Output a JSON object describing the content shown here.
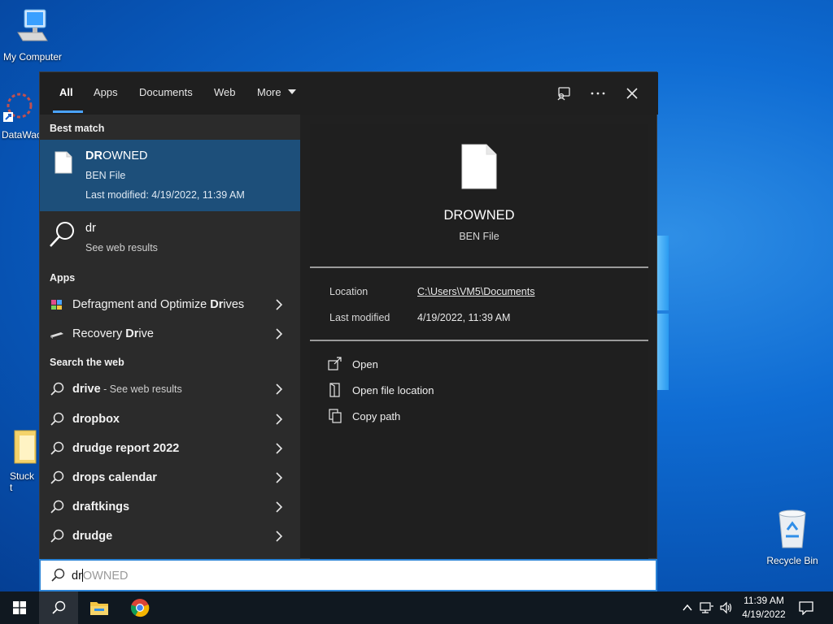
{
  "desktop": {
    "icons": [
      {
        "label": "My Computer"
      },
      {
        "label": "DataWac"
      },
      {
        "label": "Stuck t"
      },
      {
        "label": "Recycle Bin"
      }
    ]
  },
  "tabs": {
    "items": [
      "All",
      "Apps",
      "Documents",
      "Web",
      "More"
    ],
    "active": "All"
  },
  "best_match": {
    "header": "Best match",
    "name_match": "DR",
    "name_rest": "OWNED",
    "type": "BEN File",
    "modified": "Last modified: 4/19/2022, 11:39 AM"
  },
  "web_result": {
    "query": "dr",
    "label": "See web results"
  },
  "apps": {
    "header": "Apps",
    "items": [
      {
        "plain": "Defragment and Optimize ",
        "bold": "Dr",
        "rest": "ives"
      },
      {
        "plain": "Recovery ",
        "bold": "Dr",
        "rest": "ive"
      }
    ]
  },
  "search_web": {
    "header": "Search the web",
    "items": [
      {
        "text": "drive",
        "sub": " - See web results"
      },
      {
        "text": "dropbox",
        "sub": ""
      },
      {
        "text": "drudge report 2022",
        "sub": ""
      },
      {
        "text": "drops calendar",
        "sub": ""
      },
      {
        "text": "draftkings",
        "sub": ""
      },
      {
        "text": "drudge",
        "sub": ""
      }
    ]
  },
  "preview": {
    "title": "DROWNED",
    "type": "BEN File",
    "location_label": "Location",
    "location_value": "C:\\Users\\VM5\\Documents",
    "modified_label": "Last modified",
    "modified_value": "4/19/2022, 11:39 AM",
    "actions": [
      "Open",
      "Open file location",
      "Copy path"
    ]
  },
  "searchbox": {
    "typed": "dr",
    "ghost": "OWNED"
  },
  "taskbar": {
    "time": "11:39 AM",
    "date": "4/19/2022"
  },
  "colors": {
    "accent": "#4aa3ff",
    "selected": "#1d4f7a",
    "panel": "#202020"
  }
}
